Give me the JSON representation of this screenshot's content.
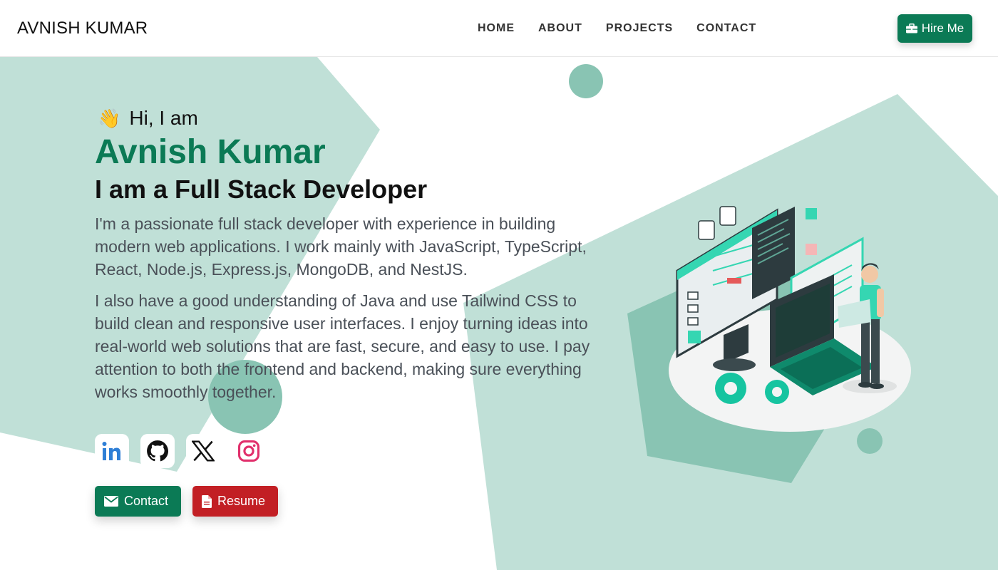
{
  "header": {
    "brand": "AVNISH KUMAR",
    "nav": [
      "HOME",
      "ABOUT",
      "PROJECTS",
      "CONTACT"
    ],
    "hire_label": "Hire Me"
  },
  "hero": {
    "greeting": "Hi, I am",
    "name": "Avnish Kumar",
    "role": "I am a Full Stack Developer",
    "para1": "I'm a passionate full stack developer with experience in building modern web applications. I work mainly with JavaScript, TypeScript, React, Node.js, Express.js, MongoDB, and NestJS.",
    "para2": "I also have a good understanding of Java and use Tailwind CSS to build clean and responsive user interfaces. I enjoy turning ideas into real-world web solutions that are fast, secure, and easy to use. I pay attention to both the frontend and backend, making sure everything works smoothly together."
  },
  "socials": [
    "linkedin-icon",
    "github-icon",
    "x-icon",
    "instagram-icon"
  ],
  "actions": {
    "contact_label": "Contact",
    "resume_label": "Resume"
  },
  "colors": {
    "accent": "#0b7a55",
    "resume": "#c21f24",
    "shape_light": "#c0e0d7",
    "shape_mid": "#89c4b3"
  }
}
